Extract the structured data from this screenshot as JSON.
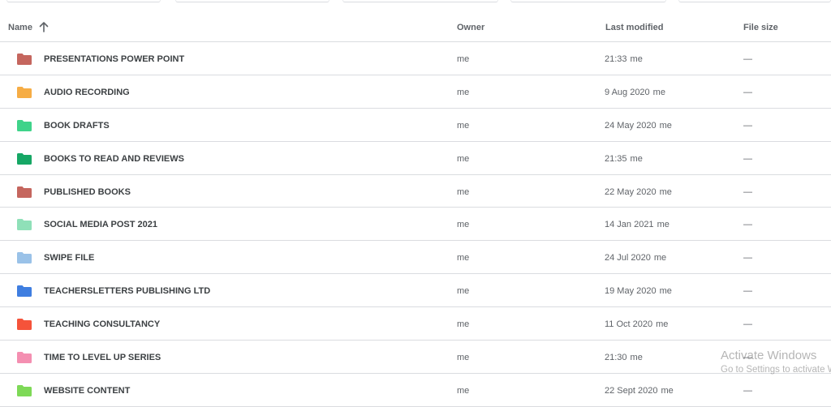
{
  "header": {
    "name": "Name",
    "owner": "Owner",
    "last_modified": "Last modified",
    "file_size": "File size",
    "sort_icon": "arrow-up-icon"
  },
  "rows": [
    {
      "name": " PRESENTATIONS POWER POINT",
      "owner": "me",
      "modified": "21:33",
      "modified_by": "me",
      "size": "—",
      "color": "#c5665e"
    },
    {
      "name": "AUDIO RECORDING",
      "owner": "me",
      "modified": "9 Aug 2020",
      "modified_by": "me",
      "size": "—",
      "color": "#f6ad45"
    },
    {
      "name": "BOOK DRAFTS",
      "owner": "me",
      "modified": "24 May 2020",
      "modified_by": "me",
      "size": "—",
      "color": "#3fd38a"
    },
    {
      "name": "BOOKS TO READ AND REVIEWS",
      "owner": "me",
      "modified": "21:35",
      "modified_by": "me",
      "size": "—",
      "color": "#16a765"
    },
    {
      "name": "PUBLISHED BOOKS",
      "owner": "me",
      "modified": "22 May 2020",
      "modified_by": "me",
      "size": "—",
      "color": "#c5665e"
    },
    {
      "name": "SOCIAL MEDIA POST 2021",
      "owner": "me",
      "modified": "14 Jan 2021",
      "modified_by": "me",
      "size": "—",
      "color": "#8fe0b8"
    },
    {
      "name": "SWIPE FILE",
      "owner": "me",
      "modified": "24 Jul 2020",
      "modified_by": "me",
      "size": "—",
      "color": "#9ac2e8"
    },
    {
      "name": "TEACHERSLETTERS PUBLISHING LTD",
      "owner": "me",
      "modified": "19 May 2020",
      "modified_by": "me",
      "size": "—",
      "color": "#3f7ee0"
    },
    {
      "name": "TEACHING CONSULTANCY",
      "owner": "me",
      "modified": "11 Oct 2020",
      "modified_by": "me",
      "size": "—",
      "color": "#f5533a"
    },
    {
      "name": "TIME TO LEVEL UP SERIES",
      "owner": "me",
      "modified": "21:30",
      "modified_by": "me",
      "size": "—",
      "color": "#f48fb1"
    },
    {
      "name": "WEBSITE CONTENT",
      "owner": "me",
      "modified": "22 Sept 2020",
      "modified_by": "me",
      "size": "—",
      "color": "#7ed957"
    }
  ],
  "watermark": {
    "line1": "Activate Windows",
    "line2": "Go to Settings to activate Windows."
  }
}
